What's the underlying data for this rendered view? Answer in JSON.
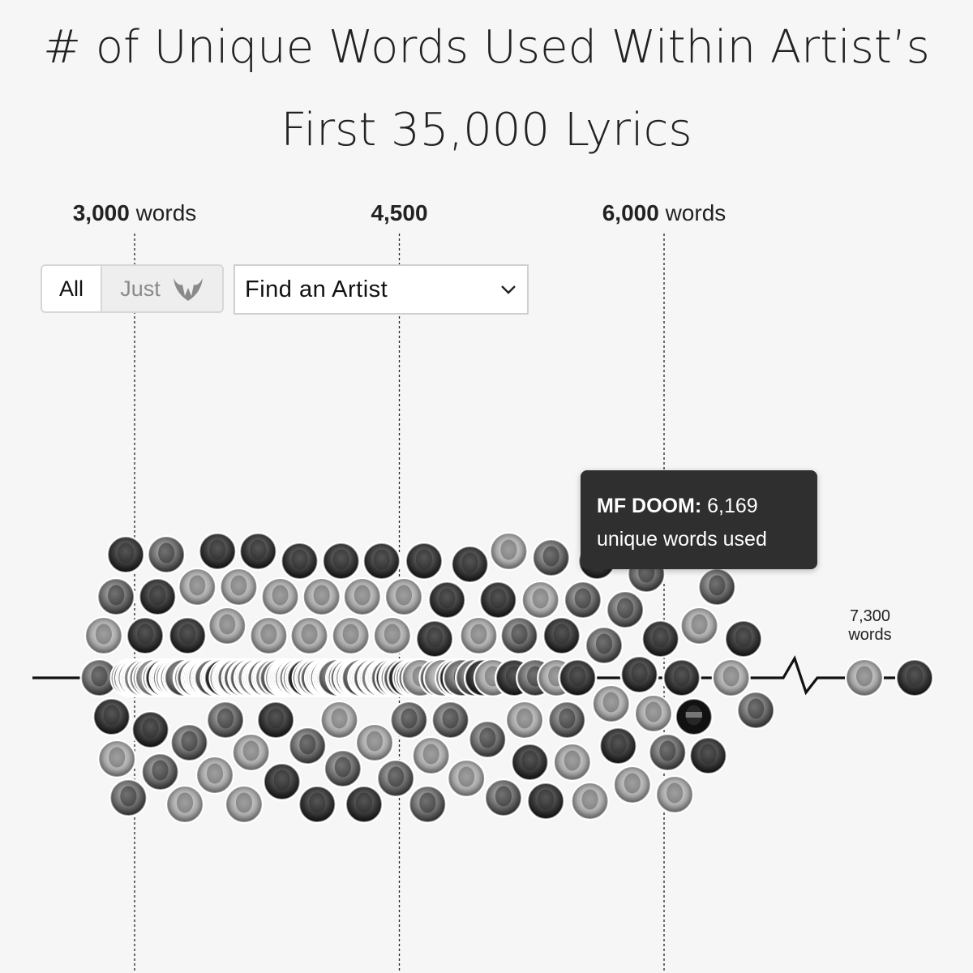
{
  "title": {
    "line1": "# of Unique Words Used Within Artist’s",
    "line2": "First 35,000 Lyrics"
  },
  "controls": {
    "toggle_all": "All",
    "toggle_just": "Just",
    "toggle_just_icon": "wu-tang-logo-icon",
    "find_artist": "Find an Artist"
  },
  "tooltip": {
    "artist": "MF DOOM",
    "value": "6,169",
    "suffix": "unique words used"
  },
  "chart_data": {
    "type": "beeswarm",
    "x_axis": {
      "ticks": [
        {
          "value": 3000,
          "bold": "3,000",
          "unit": "words"
        },
        {
          "value": 4500,
          "bold": "4,500",
          "unit": ""
        },
        {
          "value": 6000,
          "bold": "6,000",
          "unit": "words"
        }
      ],
      "break_after": 6700,
      "outlier_label": [
        "7,300",
        "words"
      ]
    },
    "highlighted": {
      "artist": "MF DOOM",
      "value": 6169
    },
    "artists_values": [
      2800,
      2825,
      2870,
      2895,
      2900,
      2950,
      2965,
      2970,
      2985,
      3000,
      3010,
      3025,
      3035,
      3045,
      3060,
      3070,
      3075,
      3090,
      3095,
      3110,
      3130,
      3145,
      3150,
      3165,
      3180,
      3190,
      3200,
      3210,
      3225,
      3240,
      3245,
      3250,
      3265,
      3275,
      3285,
      3300,
      3310,
      3325,
      3330,
      3345,
      3355,
      3370,
      3380,
      3390,
      3400,
      3410,
      3425,
      3435,
      3445,
      3455,
      3470,
      3480,
      3490,
      3500,
      3515,
      3525,
      3530,
      3545,
      3555,
      3565,
      3575,
      3590,
      3600,
      3610,
      3620,
      3635,
      3645,
      3660,
      3670,
      3680,
      3690,
      3700,
      3715,
      3725,
      3735,
      3745,
      3760,
      3770,
      3780,
      3790,
      3800,
      3815,
      3825,
      3835,
      3845,
      3860,
      3870,
      3880,
      3890,
      3900,
      3915,
      3925,
      3935,
      3945,
      3960,
      3970,
      3980,
      3990,
      4000,
      4015,
      4025,
      4035,
      4045,
      4060,
      4070,
      4080,
      4090,
      4100,
      4115,
      4125,
      4135,
      4145,
      4160,
      4170,
      4180,
      4190,
      4200,
      4215,
      4225,
      4235,
      4245,
      4260,
      4270,
      4280,
      4290,
      4300,
      4315,
      4325,
      4335,
      4345,
      4360,
      4370,
      4380,
      4390,
      4400,
      4415,
      4425,
      4435,
      4445,
      4460,
      4470,
      4480,
      4490,
      4500,
      4515,
      4525,
      4540,
      4555,
      4570,
      4585,
      4600,
      4620,
      4640,
      4660,
      4680,
      4700,
      4720,
      4745,
      4770,
      4790,
      4810,
      4830,
      4855,
      4880,
      4900,
      4925,
      4950,
      4975,
      5000,
      5030,
      5060,
      5090,
      5120,
      5150,
      5180,
      5210,
      5240,
      5270,
      5300,
      5330,
      5360,
      5390,
      5420,
      5450,
      5480,
      5510,
      5540,
      5580,
      5620,
      5660,
      5700,
      5740,
      5780,
      5820,
      5860,
      5900,
      5940,
      5980,
      6020,
      6060,
      6100,
      6169,
      6200,
      6250,
      6300,
      6380,
      6450,
      6520,
      7300,
      7400
    ]
  }
}
